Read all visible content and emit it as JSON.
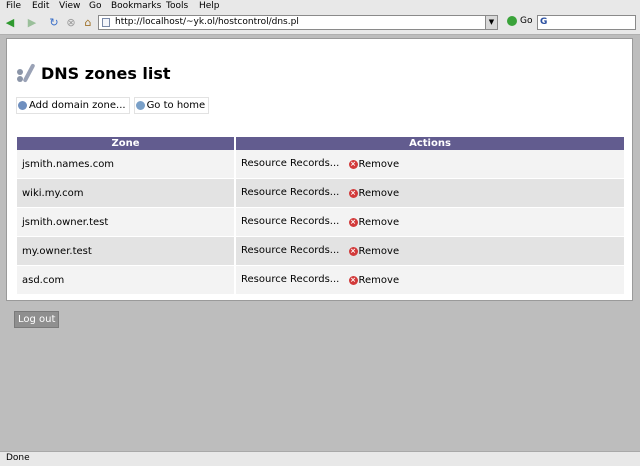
{
  "menu": [
    "File",
    "Edit",
    "View",
    "Go",
    "Bookmarks",
    "Tools",
    "Help"
  ],
  "toolbar": {
    "url": "http://localhost/~yk.ol/hostcontrol/dns.pl",
    "go_label": "Go",
    "icons": [
      "back-icon",
      "forward-icon",
      "reload-icon",
      "stop-icon",
      "home-icon"
    ]
  },
  "page": {
    "title": "DNS zones list",
    "add_zone_label": "Add domain zone...",
    "go_home_label": "Go to home"
  },
  "table": {
    "headers": [
      "Zone",
      "Actions"
    ],
    "rows": [
      {
        "zone": "jsmith.names.com",
        "records": "Resource Records...",
        "remove": "Remove"
      },
      {
        "zone": "wiki.my.com",
        "records": "Resource Records...",
        "remove": "Remove"
      },
      {
        "zone": "jsmith.owner.test",
        "records": "Resource Records...",
        "remove": "Remove"
      },
      {
        "zone": "my.owner.test",
        "records": "Resource Records...",
        "remove": "Remove"
      },
      {
        "zone": "asd.com",
        "records": "Resource Records...",
        "remove": "Remove"
      }
    ]
  },
  "logout_label": "Log out",
  "status": "Done",
  "colors": {
    "header_bg": "#625c8f",
    "row_odd": "#f3f3f3",
    "row_even": "#e3e3e3",
    "remove_icon": "#d23a3a",
    "page_bg": "#bdbdbd"
  }
}
